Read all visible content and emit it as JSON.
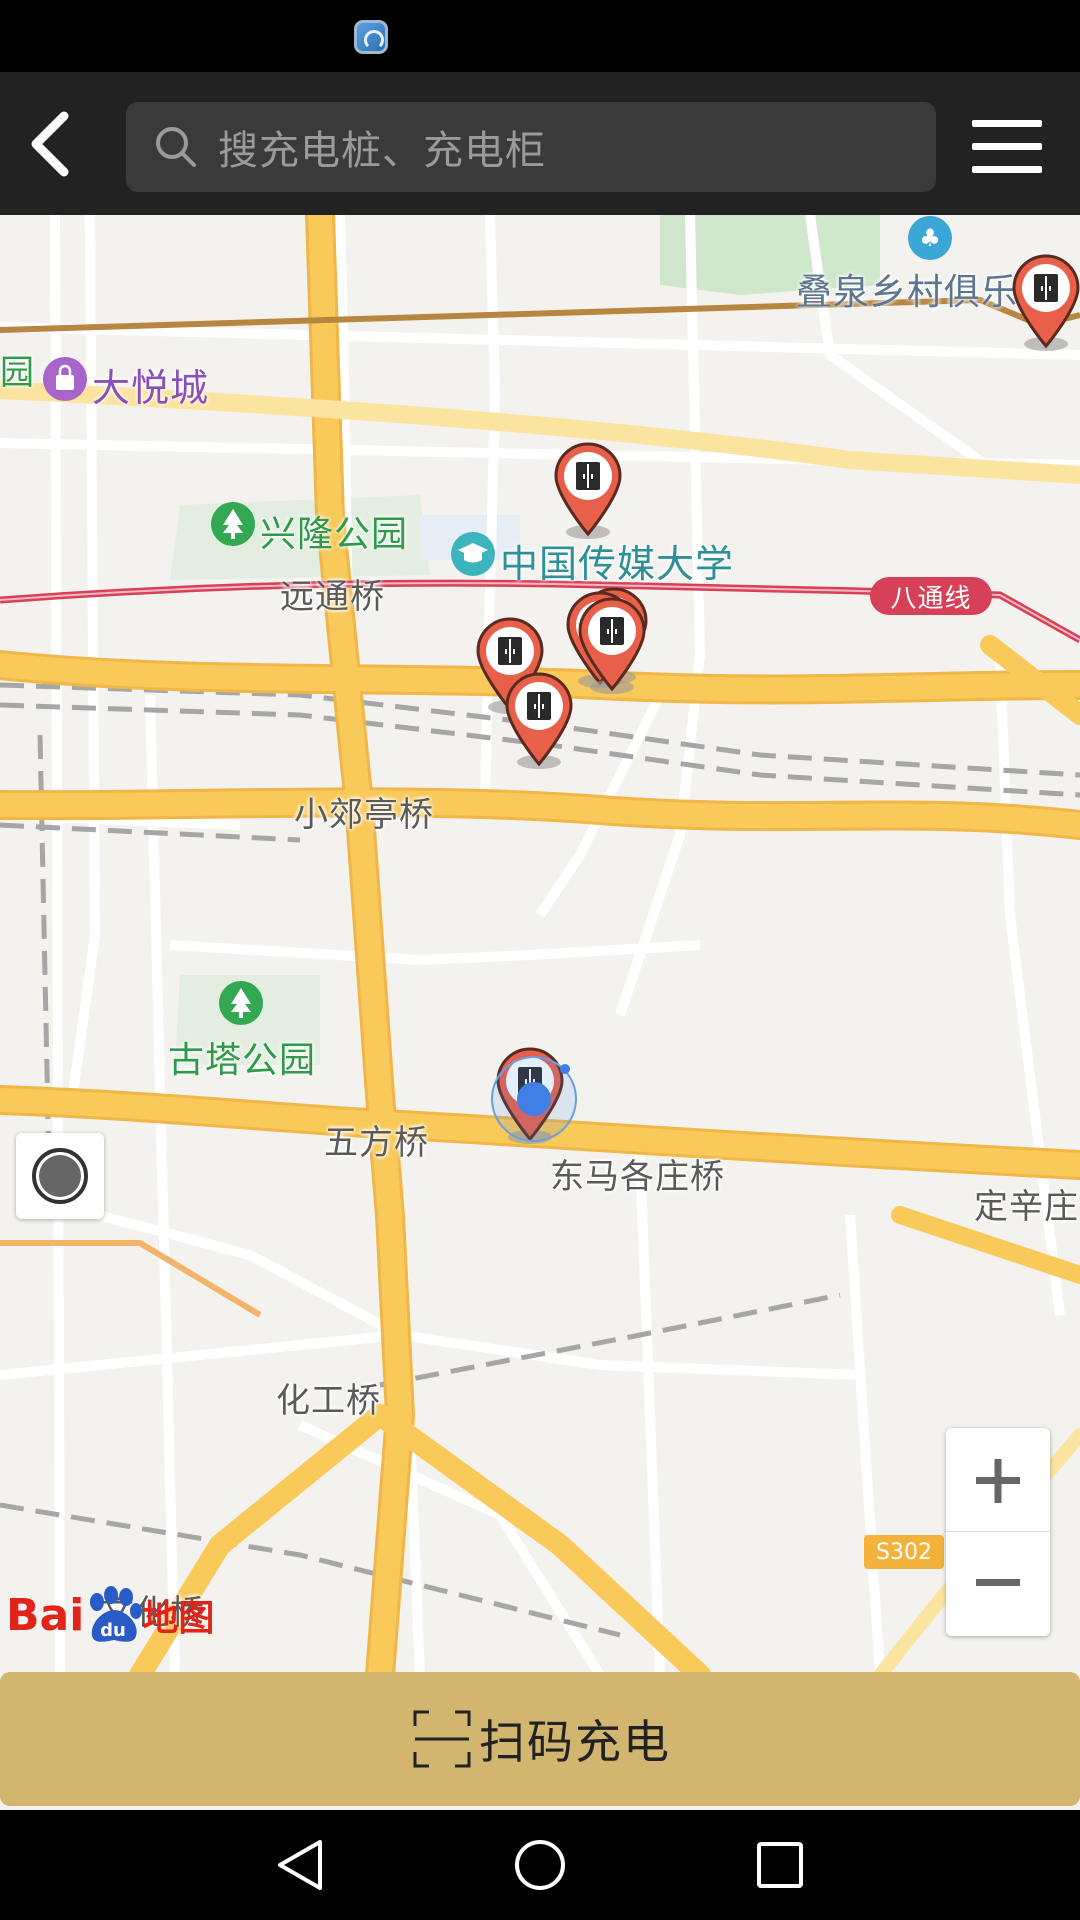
{
  "header": {
    "search_placeholder": "搜充电桩、充电柜"
  },
  "map": {
    "labels": {
      "yuan_fragment": "园",
      "dayuecheng": "大悦城",
      "xinglong_park": "兴隆公园",
      "cuc": "中国传媒大学",
      "yuantong_bridge": "远通桥",
      "diequan": "叠泉乡村俱乐",
      "xiaojiaoting_bridge": "小郊亭桥",
      "guta_park": "古塔公园",
      "wufang_bridge": "五方桥",
      "dongmagezhuang_bridge": "东马各庄桥",
      "dingxinzhuang": "定辛庄",
      "huagong_bridge": "化工桥",
      "wenhua_bridge": "文化桥"
    },
    "metro_line": "八通线",
    "route_code": "S302",
    "colors": {
      "main_road": "#f9c95a",
      "metro": "#d64158",
      "marker": "#e8604a"
    },
    "marker_icon": "charging-cabinet-icon",
    "logo": {
      "bai": "Bai",
      "du": "du",
      "ditu": "地图"
    }
  },
  "scan": {
    "label": "扫码充电"
  }
}
